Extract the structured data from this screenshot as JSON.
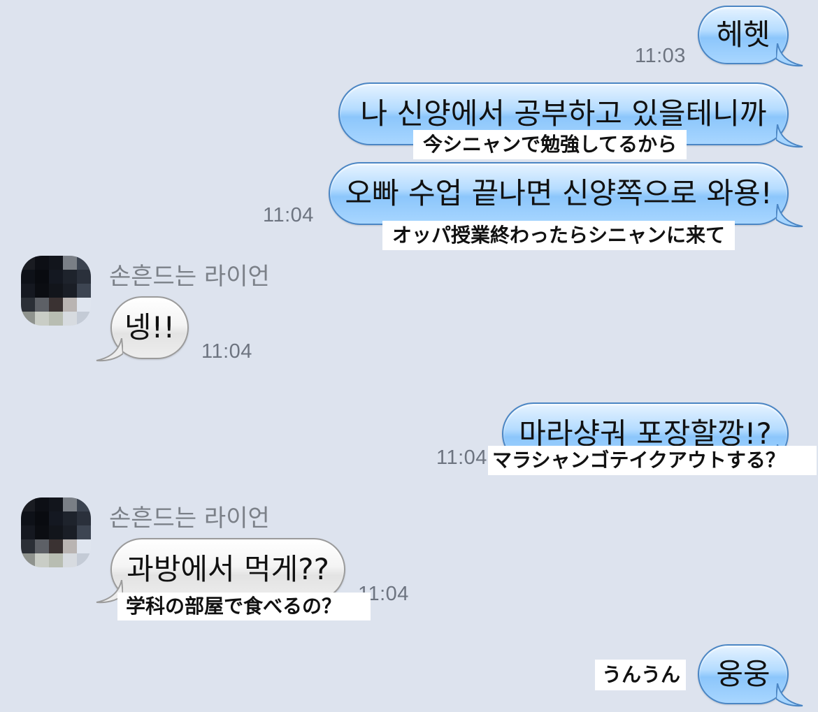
{
  "messages": [
    {
      "id": "m1",
      "text": "헤헷",
      "time": "11:03"
    },
    {
      "id": "m2",
      "text": "나 신양에서 공부하고 있을테니까",
      "caption": "今シニャンで勉強してるから"
    },
    {
      "id": "m3",
      "text": "오빠 수업 끝나면 신양쪽으로 와용!",
      "time": "11:04",
      "caption": "オッパ授業終わったらシニャンに来て"
    },
    {
      "id": "m4",
      "sender": "손흔드는 라이언",
      "text": "넹!!",
      "time": "11:04"
    },
    {
      "id": "m5",
      "text": "마라샹궈 포장할깡!?",
      "time": "11:04",
      "caption": "マラシャンゴテイクアウトする？"
    },
    {
      "id": "m6",
      "sender": "손흔드는 라이언",
      "text": "과방에서 먹게??",
      "time": "11:04",
      "caption": "学科の部屋で食べるの？"
    },
    {
      "id": "m7",
      "text": "웅웅",
      "caption": "うんうん"
    }
  ],
  "colors": {
    "background": "#dde3ee",
    "my_bubble": "#a8d6ff",
    "my_bubble_border": "#4b86c4",
    "their_bubble": "#ededed",
    "their_bubble_border": "#9b9b9b",
    "timestamp": "#6d7480"
  },
  "icons": {
    "avatar": "pixelated-avatar-icon"
  }
}
